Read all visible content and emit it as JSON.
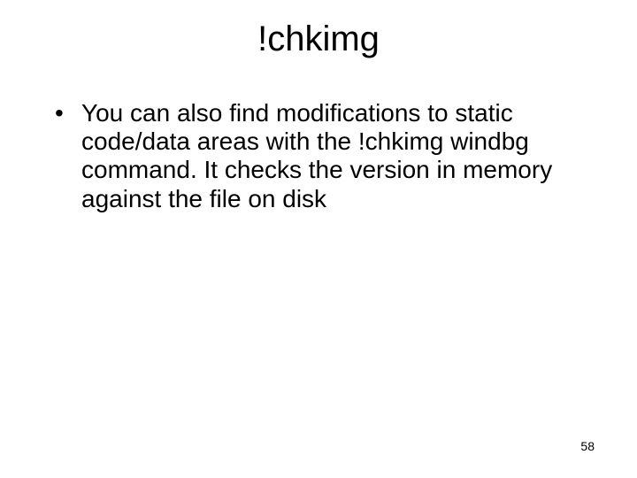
{
  "title": "!chkimg",
  "bullets": [
    "You can also find modifications to static code/data areas with the !chkimg windbg command. It checks the version in memory against the file on disk"
  ],
  "page_number": "58"
}
